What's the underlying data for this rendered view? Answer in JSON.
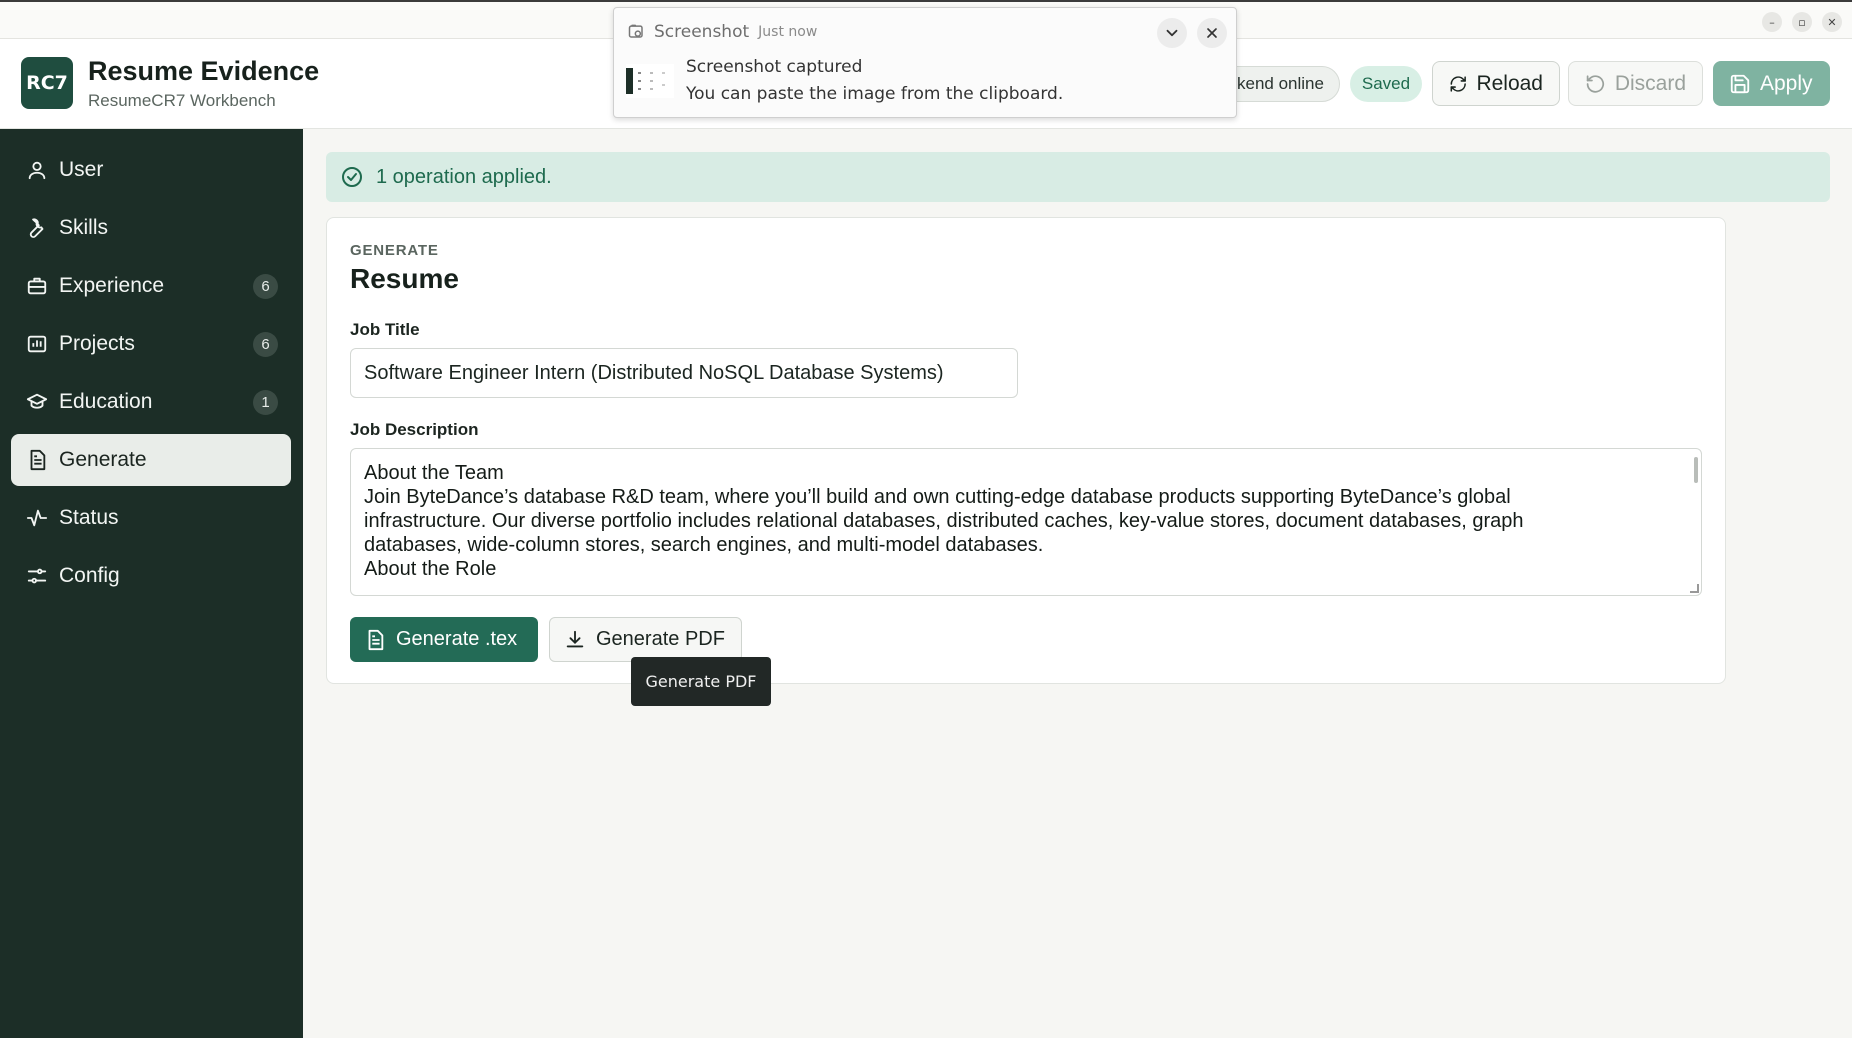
{
  "window": {
    "controls": [
      "–",
      "▫",
      "✕"
    ]
  },
  "header": {
    "logo": "RC7",
    "title": "Resume Evidence",
    "subtitle": "ResumeCR7 Workbench",
    "status_backend": "kend online",
    "status_saved": "Saved",
    "reload_label": "Reload",
    "discard_label": "Discard",
    "apply_label": "Apply"
  },
  "sidebar": {
    "items": [
      {
        "label": "User",
        "icon": "user-icon"
      },
      {
        "label": "Skills",
        "icon": "wrench-icon"
      },
      {
        "label": "Experience",
        "icon": "briefcase-icon",
        "count": "6"
      },
      {
        "label": "Projects",
        "icon": "presentation-icon",
        "count": "6"
      },
      {
        "label": "Education",
        "icon": "graduation-cap-icon",
        "count": "1"
      },
      {
        "label": "Generate",
        "icon": "document-icon",
        "active": true
      },
      {
        "label": "Status",
        "icon": "activity-icon"
      },
      {
        "label": "Config",
        "icon": "sliders-icon"
      }
    ]
  },
  "alert": {
    "message": "1 operation applied."
  },
  "card": {
    "eyebrow": "GENERATE",
    "title": "Resume",
    "job_title_label": "Job Title",
    "job_title_value": "Software Engineer Intern (Distributed NoSQL Database Systems)",
    "job_description_label": "Job Description",
    "job_description_lines": [
      "About the Team",
      "Join ByteDance’s database R&D team, where you’ll build and own cutting-edge database products supporting ByteDance’s global",
      "infrastructure. Our diverse portfolio includes relational databases, distributed caches, key-value stores, document databases, graph",
      "databases, wide-column stores, search engines, and multi-model databases.",
      "",
      "About the Role"
    ],
    "generate_tex_label": "Generate .tex",
    "generate_pdf_label": "Generate PDF"
  },
  "tooltip": {
    "text": "Generate PDF"
  },
  "notification": {
    "app": "Screenshot",
    "time": "Just now",
    "summary": "Screenshot captured",
    "body": "You can paste the image from the clipboard."
  },
  "colors": {
    "sidebar_bg": "#1c2e27",
    "accent": "#236b56",
    "apply_disabled": "#7fb3a1",
    "alert_bg": "#d8ece4"
  }
}
